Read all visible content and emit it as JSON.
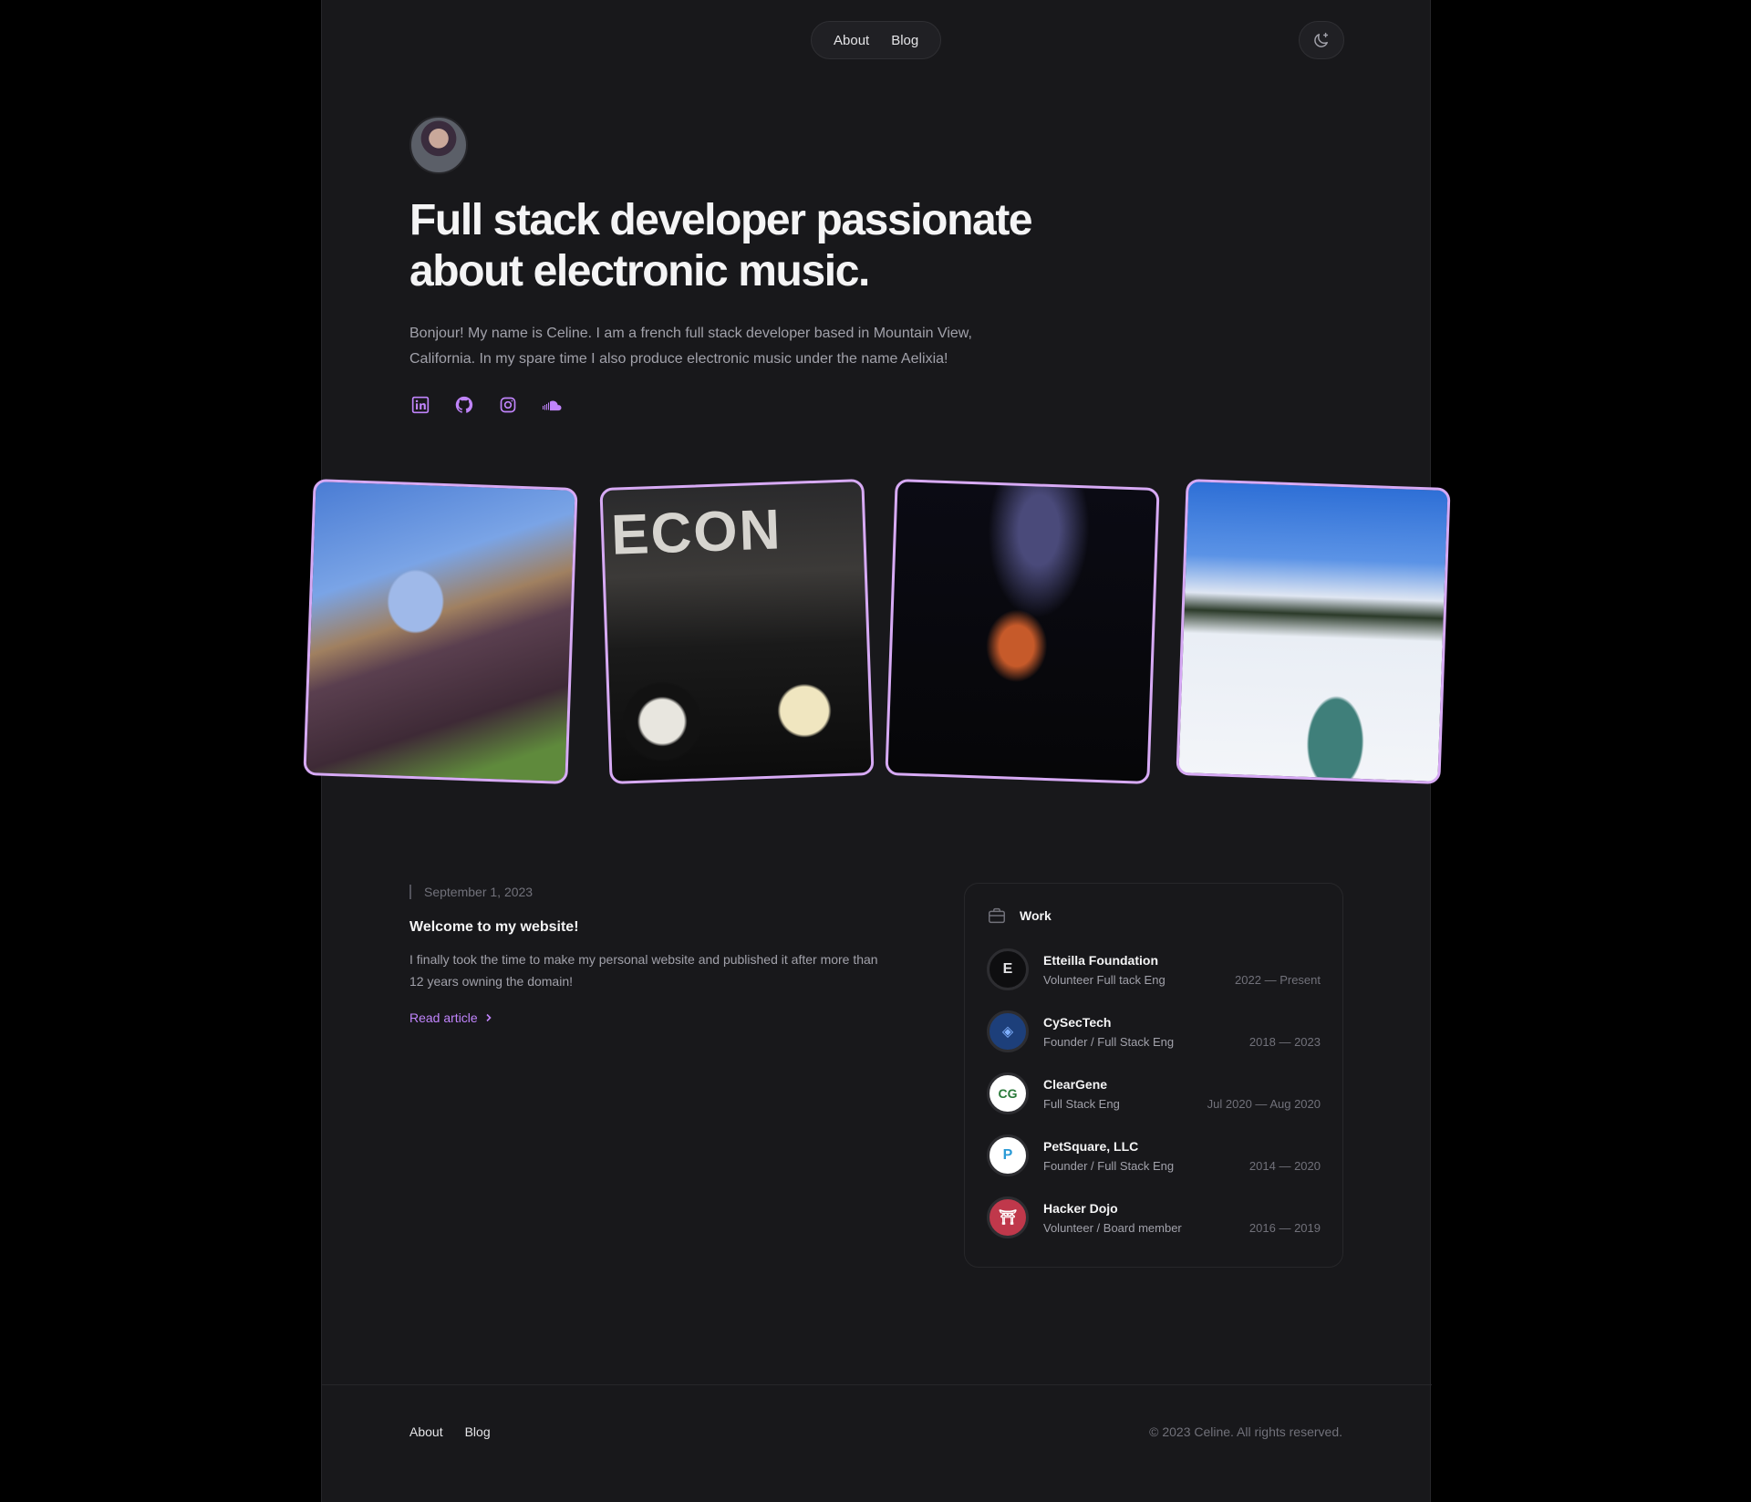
{
  "nav": {
    "items": [
      "About",
      "Blog"
    ]
  },
  "theme_toggle": {
    "icon": "moon-icon"
  },
  "hero": {
    "title": "Full stack developer passionate about electronic music.",
    "intro": "Bonjour! My name is Celine. I am a french full stack developer based in Mountain View, California. In my spare time I also produce electronic music under the name Aelixia!",
    "socials": [
      "linkedin-icon",
      "github-icon",
      "instagram-icon",
      "soundcloud-icon"
    ]
  },
  "photos": {
    "accent": "#d7aaf5",
    "p2_text": "ECON"
  },
  "article": {
    "date": "September 1, 2023",
    "title": "Welcome to my website!",
    "summary": "I finally took the time to make my personal website and published it after more than 12 years owning the domain!",
    "link": "Read article"
  },
  "work": {
    "heading": "Work",
    "items": [
      {
        "name": "Etteilla Foundation",
        "role": "Volunteer Full tack Eng",
        "dates": "2022 — Present",
        "logo": "E"
      },
      {
        "name": "CySecTech",
        "role": "Founder / Full Stack Eng",
        "dates": "2018 — 2023",
        "logo": "◈"
      },
      {
        "name": "ClearGene",
        "role": "Full Stack Eng",
        "dates": "Jul 2020 — Aug 2020",
        "logo": "CG"
      },
      {
        "name": "PetSquare, LLC",
        "role": "Founder / Full Stack Eng",
        "dates": "2014 — 2020",
        "logo": "P"
      },
      {
        "name": "Hacker Dojo",
        "role": "Volunteer / Board member",
        "dates": "2016 — 2019",
        "logo": "⛩"
      }
    ]
  },
  "footer": {
    "nav": [
      "About",
      "Blog"
    ],
    "copyright": "© 2023 Celine. All rights reserved."
  },
  "colors": {
    "accent": "#c084fc",
    "background": "#18181b"
  }
}
